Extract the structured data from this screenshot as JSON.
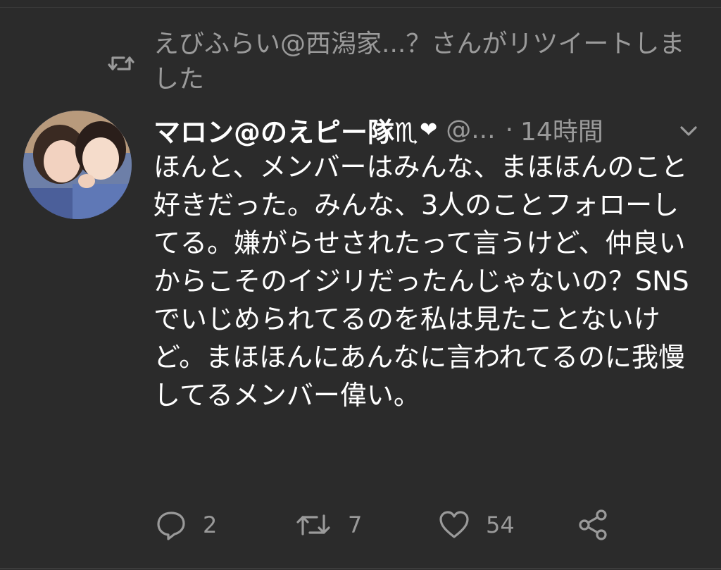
{
  "retweet_banner": {
    "icon": "retweet-icon",
    "text": "えびふらい@西潟家...？さんがリツイートしました"
  },
  "tweet": {
    "avatar": "user-avatar",
    "display_name": "マロン@のえピー隊♏",
    "name_emoji": "❤",
    "handle": "@...",
    "separator": "·",
    "time": "14時間",
    "menu_icon": "chevron-down-icon",
    "body": "ほんと、メンバーはみんな、まほほんのこと好きだった。みんな、3人のことフォローしてる。嫌がらせされたって言うけど、仲良いからこそのイジリだったんじゃないの？SNSでいじめられてるのを私は見たことないけど。まほほんにあんなに言われてるのに我慢してるメンバー偉い。"
  },
  "actions": {
    "reply": {
      "icon": "reply-icon",
      "count": "2"
    },
    "retweet": {
      "icon": "retweet-icon",
      "count": "7"
    },
    "like": {
      "icon": "heart-icon",
      "count": "54"
    },
    "share": {
      "icon": "share-icon"
    }
  },
  "colors": {
    "background": "#2b2b2b",
    "text": "#ffffff",
    "secondary": "#9a9a9a"
  }
}
